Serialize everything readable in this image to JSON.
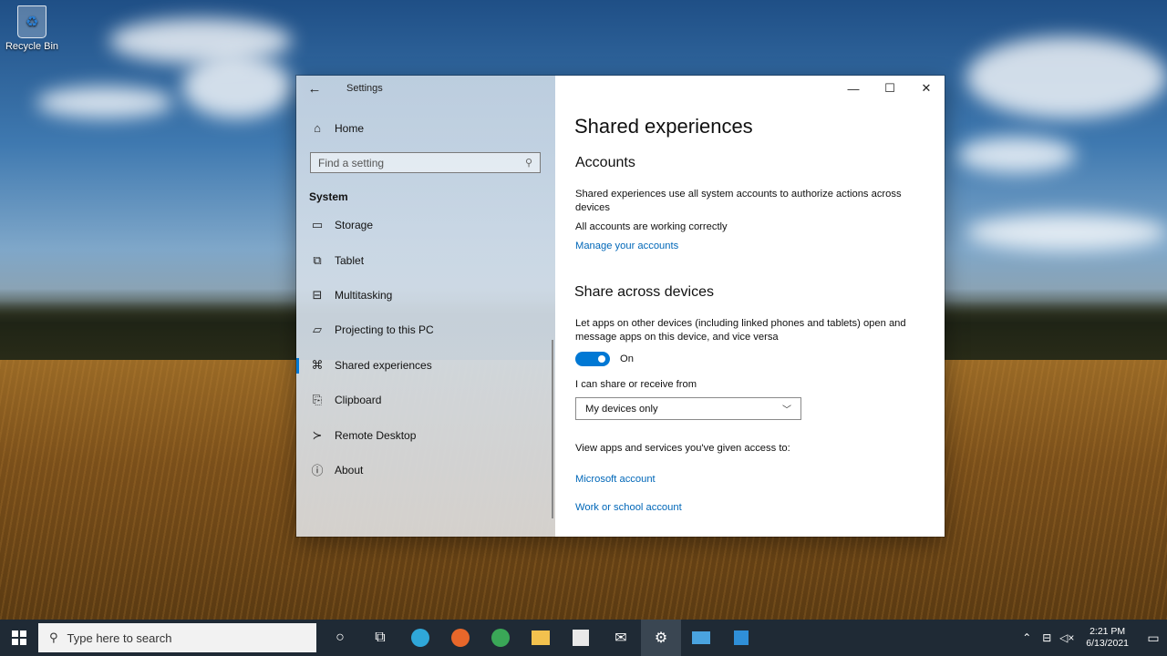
{
  "desktop": {
    "icons": [
      {
        "label": "Recycle Bin",
        "icon": "recycle-bin-icon"
      }
    ]
  },
  "window": {
    "title": "Settings",
    "controls": {
      "minimize": "—",
      "maximize": "☐",
      "close": "✕"
    }
  },
  "sidebar": {
    "home_label": "Home",
    "search_placeholder": "Find a setting",
    "section": "System",
    "items": [
      {
        "label": "Storage",
        "icon": "storage-icon",
        "glyph": "▭"
      },
      {
        "label": "Tablet",
        "icon": "tablet-icon",
        "glyph": "⧉"
      },
      {
        "label": "Multitasking",
        "icon": "multitasking-icon",
        "glyph": "⊟"
      },
      {
        "label": "Projecting to this PC",
        "icon": "projecting-icon",
        "glyph": "▱"
      },
      {
        "label": "Shared experiences",
        "icon": "shared-experiences-icon",
        "glyph": "⌘",
        "active": true
      },
      {
        "label": "Clipboard",
        "icon": "clipboard-icon",
        "glyph": "⎘"
      },
      {
        "label": "Remote Desktop",
        "icon": "remote-desktop-icon",
        "glyph": "≻"
      },
      {
        "label": "About",
        "icon": "about-icon",
        "glyph": "ⓘ"
      }
    ]
  },
  "main": {
    "page_title": "Shared experiences",
    "accounts": {
      "heading": "Accounts",
      "description": "Shared experiences use all system accounts to authorize actions across devices",
      "status": "All accounts are working correctly",
      "manage_link": "Manage your accounts"
    },
    "share": {
      "heading": "Share across devices",
      "description": "Let apps on other devices (including linked phones and tablets) open and message apps on this device, and vice versa",
      "toggle_state": "On",
      "share_from_label": "I can share or receive from",
      "share_from_value": "My devices only",
      "access_label": "View apps and services you've given access to:",
      "links": [
        "Microsoft account",
        "Work or school account"
      ]
    }
  },
  "taskbar": {
    "search_placeholder": "Type here to search",
    "apps": [
      {
        "name": "cortana-icon",
        "glyph": "○"
      },
      {
        "name": "task-view-icon",
        "glyph": "⧉"
      },
      {
        "name": "edge-icon",
        "color": "#2fa7d9"
      },
      {
        "name": "firefox-icon",
        "color": "#e8672a"
      },
      {
        "name": "chrome-icon",
        "color": "#3aa757"
      },
      {
        "name": "file-explorer-icon",
        "color": "#f2c14e"
      },
      {
        "name": "store-icon",
        "color": "#e9e9e9"
      },
      {
        "name": "mail-icon",
        "glyph": "✉"
      },
      {
        "name": "settings-icon",
        "glyph": "⚙",
        "active": true
      },
      {
        "name": "control-panel-icon",
        "color": "#4aa3df"
      },
      {
        "name": "azure-icon",
        "color": "#2f8fd8"
      }
    ],
    "time": "2:21 PM",
    "date": "6/13/2021"
  }
}
